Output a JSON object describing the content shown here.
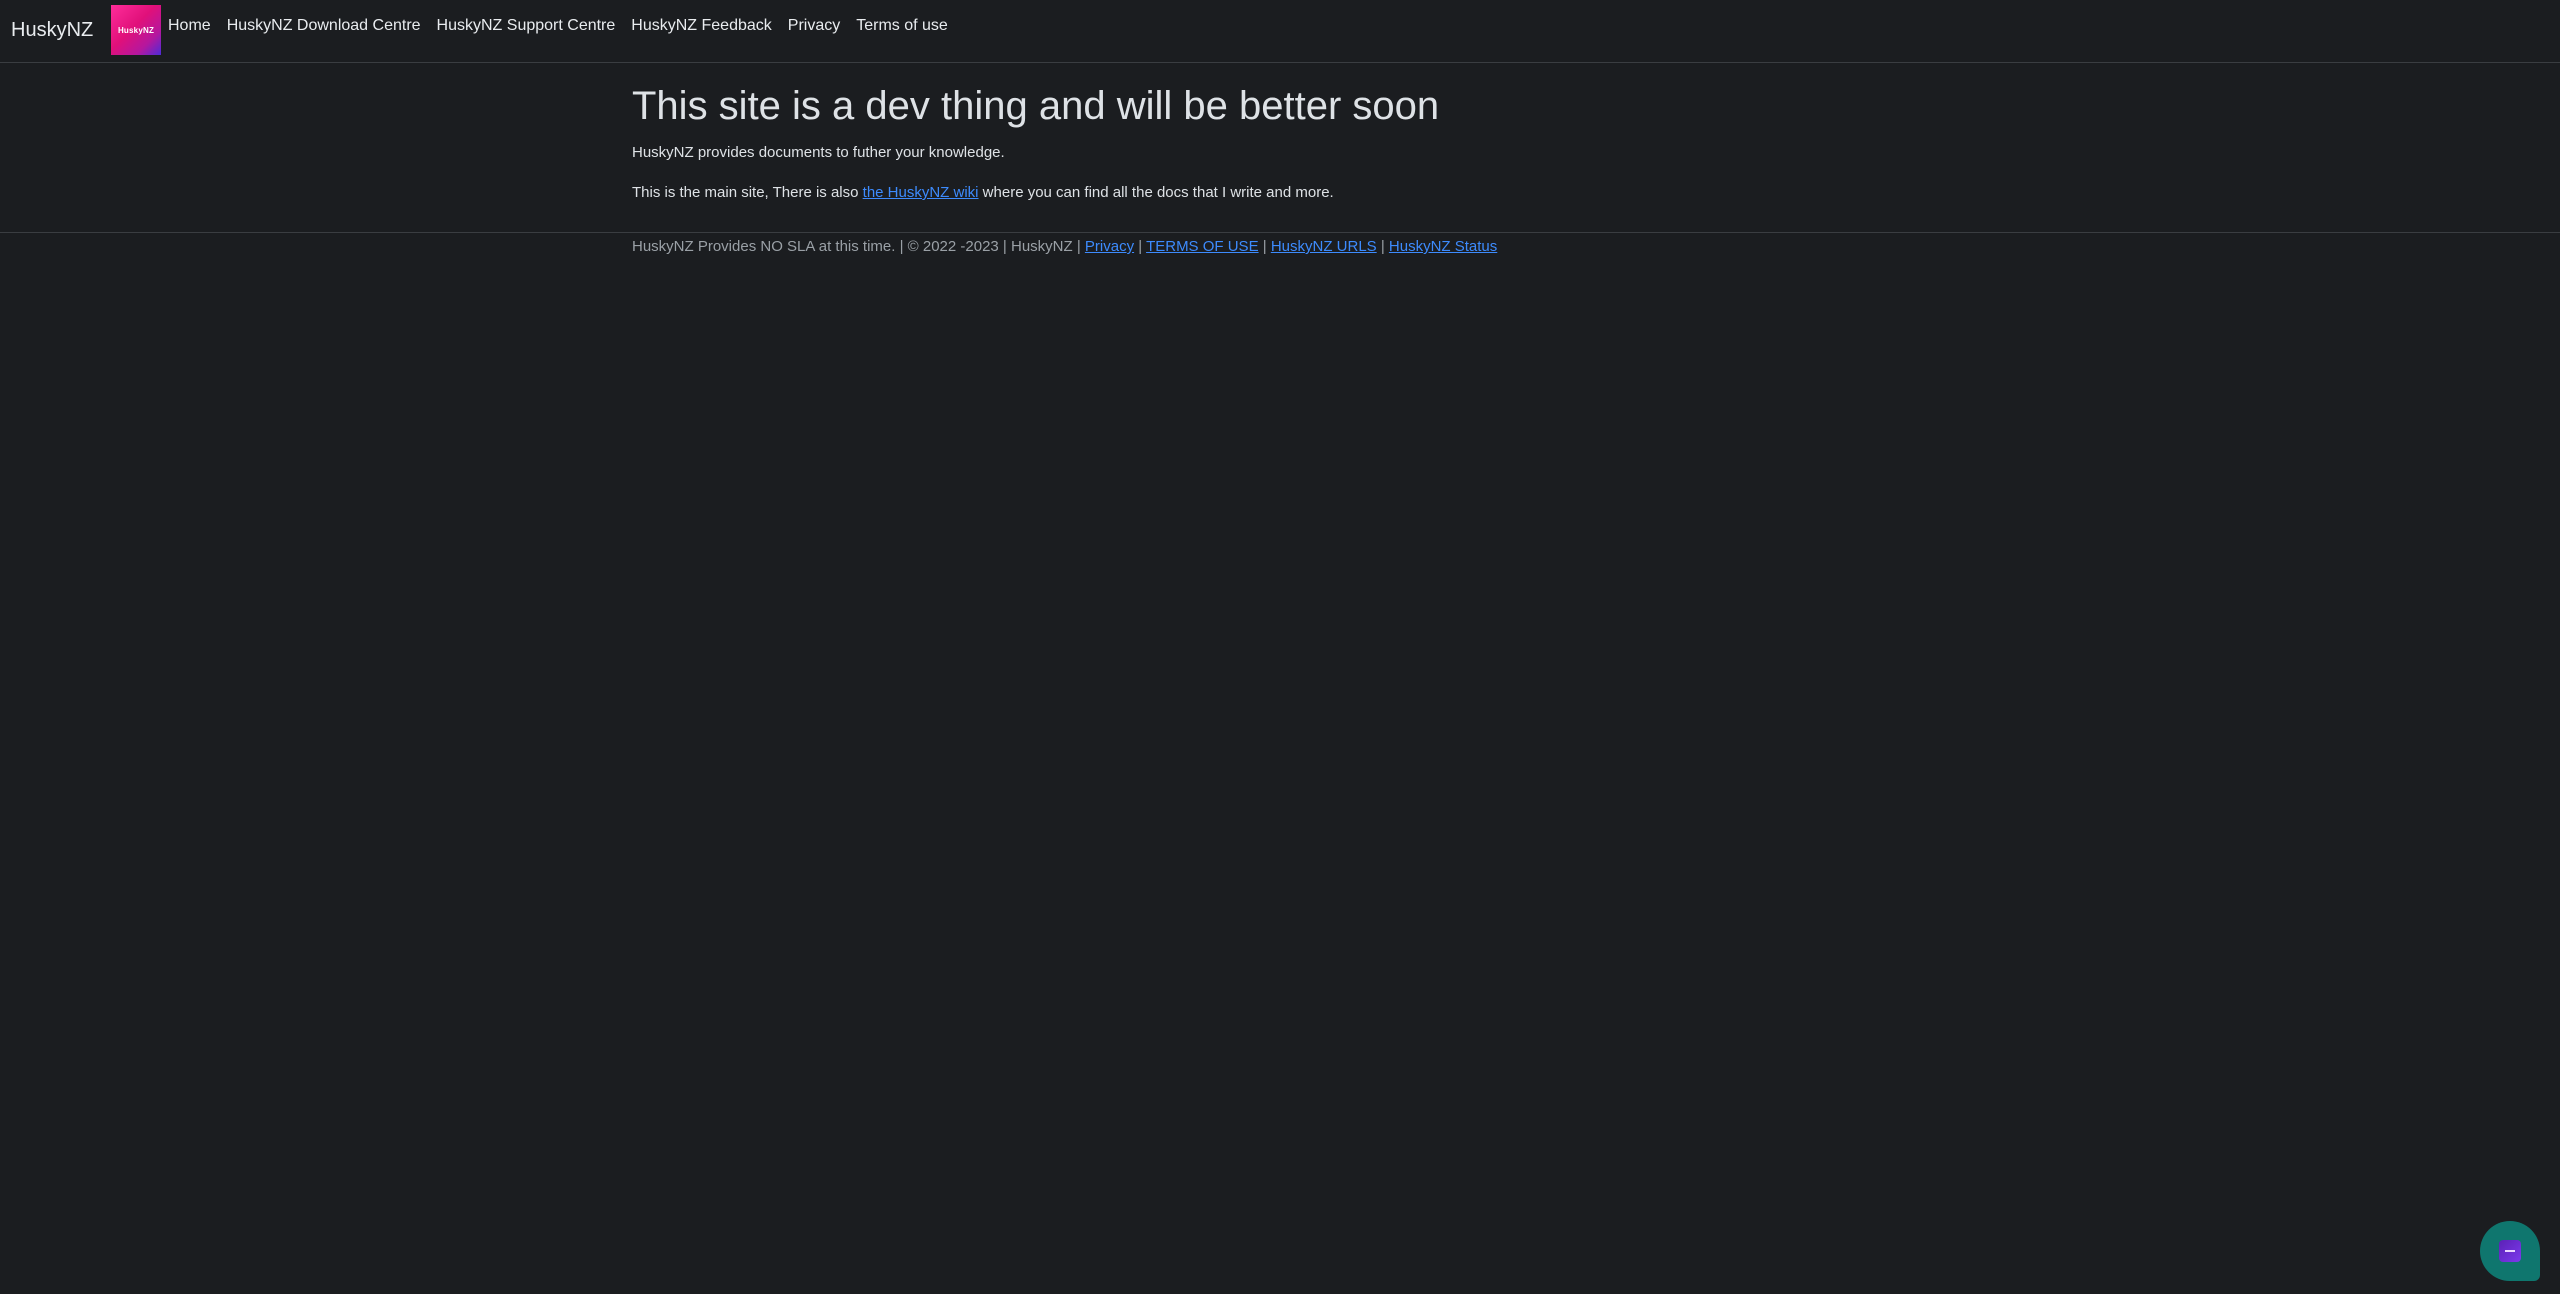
{
  "nav": {
    "brand": "HuskyNZ",
    "logo_text": "HuskyNZ",
    "links": [
      "Home",
      "HuskyNZ Download Centre",
      "HuskyNZ Support Centre",
      "HuskyNZ Feedback",
      "Privacy",
      "Terms of use"
    ]
  },
  "main": {
    "headline": "This site is a dev thing and will be better soon",
    "intro": "HuskyNZ provides documents to futher your knowledge.",
    "wiki_prefix": "This is the main site, There is also ",
    "wiki_link": "the HuskyNZ wiki",
    "wiki_suffix": " where you can find all the docs that I write and more."
  },
  "footer": {
    "text": "HuskyNZ Provides NO SLA at this time. | © 2022 -2023 | HuskyNZ | ",
    "sep": " | ",
    "links": [
      "Privacy",
      "TERMS OF USE",
      "HuskyNZ URLS",
      "HuskyNZ Status"
    ]
  },
  "chat_widget": {
    "icon": "chat-icon",
    "colors": {
      "bubble": "#0f766e",
      "icon": "#7c3aed"
    }
  },
  "colors": {
    "background": "#1b1d20",
    "text": "#dee2e6",
    "link": "#3d8bfd",
    "divider": "#3a3d41"
  }
}
